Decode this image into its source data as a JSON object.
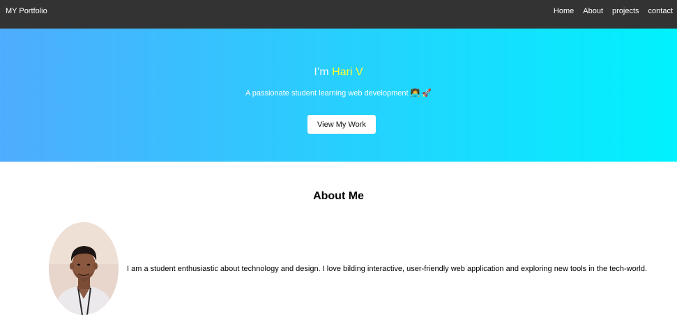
{
  "navbar": {
    "brand": "MY Portfolio",
    "links": [
      "Home",
      "About",
      "projects",
      "contact"
    ]
  },
  "hero": {
    "title_prefix": "I’m ",
    "name": "Hari V",
    "tagline": "A passionate student learning web development 👩‍💻 🚀",
    "button_label": "View My Work"
  },
  "about": {
    "heading": "About Me",
    "text": "I am a student enthusiastic about technology and design. I love bilding interactive, user-friendly web application and exploring new tools in the tech-world."
  },
  "colors": {
    "navbar_bg": "#333333",
    "hero_gradient_start": "#4facfe",
    "hero_gradient_end": "#00f2fe",
    "name_highlight": "#ffff33"
  }
}
